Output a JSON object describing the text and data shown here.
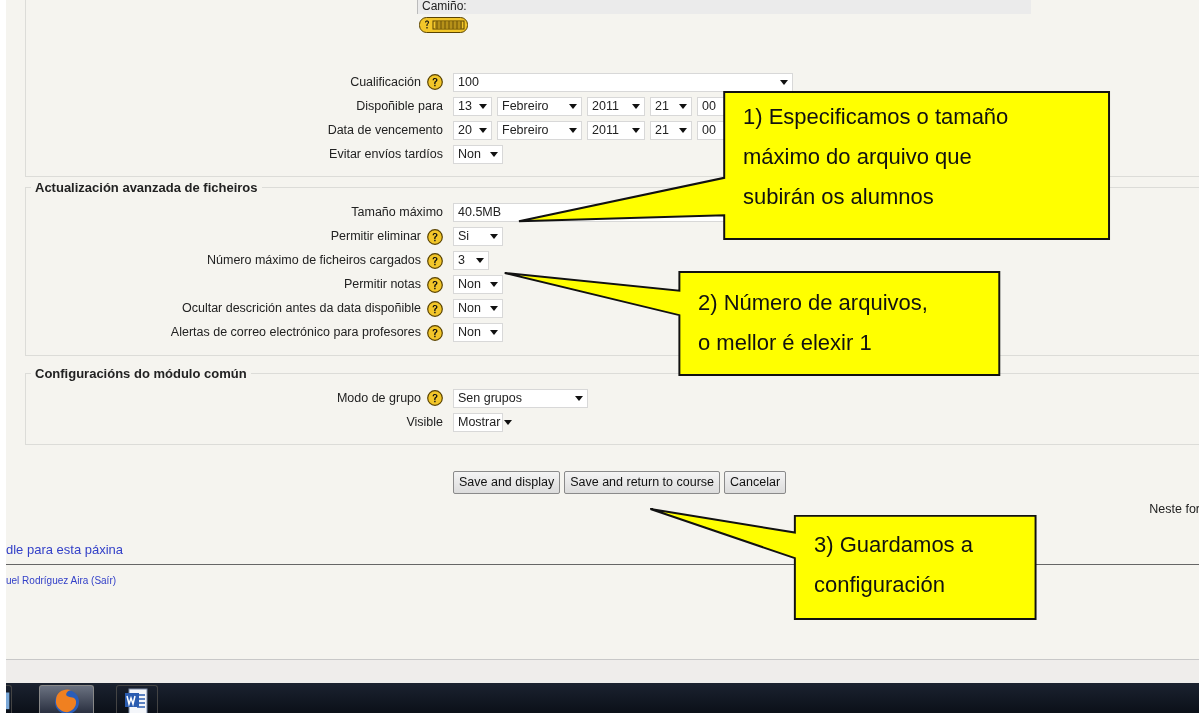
{
  "path_label": "Camiño:",
  "sections": [
    {
      "rows": [
        {
          "label": "Cualificación",
          "help": true,
          "kind": "select-wide",
          "value": "100"
        },
        {
          "label": "Dispoñible para",
          "help": false,
          "kind": "date",
          "parts": [
            "13",
            "Febreiro",
            "2011",
            "21",
            "00"
          ]
        },
        {
          "label": "Data de vencemento",
          "help": false,
          "kind": "date",
          "parts": [
            "20",
            "Febreiro",
            "2011",
            "21",
            "00"
          ]
        },
        {
          "label": "Evitar envíos tardíos",
          "help": false,
          "kind": "select",
          "value": "Non"
        }
      ]
    },
    {
      "legend": "Actualización avanzada de ficheiros",
      "rows": [
        {
          "label": "Tamaño máximo",
          "help": false,
          "kind": "text",
          "value": "40.5MB"
        },
        {
          "label": "Permitir eliminar",
          "help": true,
          "kind": "select",
          "value": "Si"
        },
        {
          "label": "Número máximo de ficheiros cargados",
          "help": true,
          "kind": "select-narrow",
          "value": "3"
        },
        {
          "label": "Permitir notas",
          "help": true,
          "kind": "select",
          "value": "Non"
        },
        {
          "label": "Ocultar descrición antes da data dispoñible",
          "help": true,
          "kind": "select",
          "value": "Non"
        },
        {
          "label": "Alertas de correo electrónico para profesores",
          "help": true,
          "kind": "select",
          "value": "Non"
        }
      ]
    },
    {
      "legend": "Configuracións do módulo común",
      "rows": [
        {
          "label": "Modo de grupo",
          "help": true,
          "kind": "select-medium",
          "value": "Sen grupos"
        },
        {
          "label": "Visible",
          "help": false,
          "kind": "select",
          "value": "Mostrar"
        }
      ]
    }
  ],
  "buttons": [
    "Save and display",
    "Save and return to course",
    "Cancelar"
  ],
  "side_note": "Neste for",
  "docs_link": "dle para esta páxina",
  "login_info": "uel Rodríguez Aira (Saír)",
  "callouts": [
    "1) Especificamos o tamaño\nmáximo do arquivo que\nsubirán os alumnos",
    "2) Número de arquivos,\no mellor é elexir 1",
    "3) Guardamos a\nconfiguración"
  ]
}
